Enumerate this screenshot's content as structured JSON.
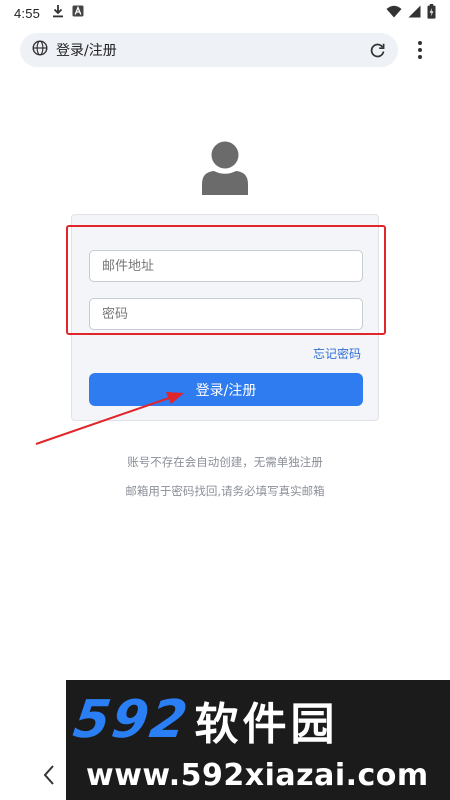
{
  "status_bar": {
    "time": "4:55",
    "left_icons": [
      "download-icon",
      "app-a-icon"
    ],
    "right_icons": [
      "wifi-icon",
      "signal-icon",
      "battery-icon"
    ]
  },
  "browser": {
    "page_title": "登录/注册",
    "site_icon": "globe-icon",
    "reload_icon": "reload-icon",
    "menu_icon": "more-vert-icon"
  },
  "login": {
    "avatar_icon": "user-avatar-icon",
    "email_placeholder": "邮件地址",
    "password_placeholder": "密码",
    "forgot_password": "忘记密码",
    "submit_label": "登录/注册"
  },
  "notes": [
    "账号不存在会自动创建，无需单独注册",
    "邮箱用于密码找回,请务必填写真实邮箱"
  ],
  "annotation": {
    "color": "#e0252b"
  },
  "colors": {
    "accent": "#2f7bf0",
    "link": "#2f6fd6",
    "watermark_digits": "#2b7ff5"
  },
  "watermark": {
    "brand_digits": "592",
    "brand_text": "软件园",
    "url": "www.592xiazai.com"
  },
  "nav": {
    "back_icon": "chevron-left-icon"
  }
}
